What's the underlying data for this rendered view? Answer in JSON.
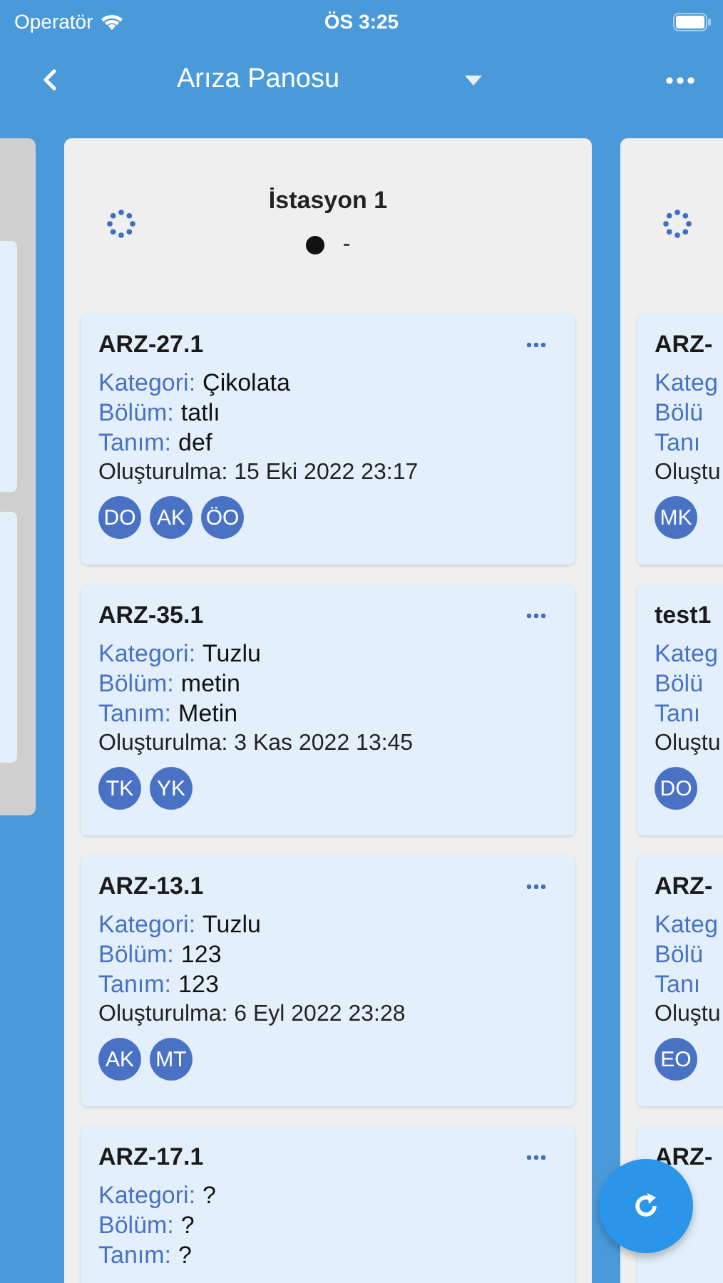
{
  "status_bar": {
    "carrier": "Operatör",
    "time": "ÖS 3:25"
  },
  "nav": {
    "title": "Arıza Panosu"
  },
  "columns": [
    {
      "kind": "stub",
      "cards": [
        {
          "kind": "stub"
        },
        {
          "kind": "stub"
        }
      ]
    },
    {
      "kind": "full",
      "title": "İstasyon 1",
      "status": "-",
      "cards": [
        {
          "kind": "full",
          "title": "ARZ-27.1",
          "fields": [
            {
              "label": "Kategori:",
              "value": "Çikolata"
            },
            {
              "label": "Bölüm:",
              "value": "tatlı"
            },
            {
              "label": "Tanım:",
              "value": "def"
            }
          ],
          "created": "Oluşturulma: 15 Eki 2022 23:17",
          "avatars": [
            "DO",
            "AK",
            "ÖO"
          ]
        },
        {
          "kind": "full",
          "title": "ARZ-35.1",
          "fields": [
            {
              "label": "Kategori:",
              "value": "Tuzlu"
            },
            {
              "label": "Bölüm:",
              "value": "metin"
            },
            {
              "label": "Tanım:",
              "value": "Metin"
            }
          ],
          "created": "Oluşturulma: 3 Kas 2022 13:45",
          "avatars": [
            "TK",
            "YK"
          ]
        },
        {
          "kind": "full",
          "title": "ARZ-13.1",
          "fields": [
            {
              "label": "Kategori:",
              "value": "Tuzlu"
            },
            {
              "label": "Bölüm:",
              "value": "123"
            },
            {
              "label": "Tanım:",
              "value": "123"
            }
          ],
          "created": "Oluşturulma: 6 Eyl 2022 23:28",
          "avatars": [
            "AK",
            "MT"
          ]
        },
        {
          "kind": "full",
          "title": "ARZ-17.1",
          "fields": [
            {
              "label": "Kategori:",
              "value": "?"
            },
            {
              "label": "Bölüm:",
              "value": "?"
            },
            {
              "label": "Tanım:",
              "value": "?"
            }
          ]
        }
      ]
    },
    {
      "kind": "cut",
      "cards": [
        {
          "kind": "cut",
          "title": "ARZ-",
          "fields": [
            {
              "label": "Kateg"
            },
            {
              "label": "Bölü"
            },
            {
              "label": "Tanı"
            }
          ],
          "created": "Oluştu",
          "avatars": [
            "MK"
          ]
        },
        {
          "kind": "cut",
          "title": "test1",
          "fields": [
            {
              "label": "Kateg"
            },
            {
              "label": "Bölü"
            },
            {
              "label": "Tanı"
            }
          ],
          "created": "Oluştu",
          "avatars": [
            "DO"
          ]
        },
        {
          "kind": "cut",
          "title": "ARZ-",
          "fields": [
            {
              "label": "Kateg"
            },
            {
              "label": "Bölü"
            },
            {
              "label": "Tanı"
            }
          ],
          "created": "Oluştu",
          "avatars": [
            "EO"
          ]
        },
        {
          "kind": "cut",
          "title": "ARZ-"
        }
      ]
    }
  ]
}
